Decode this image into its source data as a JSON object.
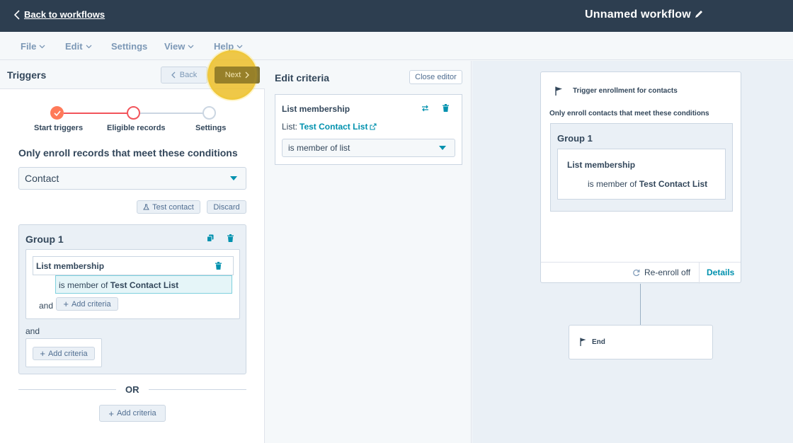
{
  "topbar": {
    "back_label": "Back to workflows",
    "workflow_title": "Unnamed workflow"
  },
  "menu": {
    "file": "File",
    "edit": "Edit",
    "settings": "Settings",
    "view": "View",
    "help": "Help"
  },
  "triggers": {
    "title": "Triggers",
    "back_label": "Back",
    "next_label": "Next",
    "steps": [
      "Start triggers",
      "Eligible records",
      "Settings"
    ],
    "conditions_title": "Only enroll records that meet these conditions",
    "object_select": "Contact",
    "test_contact_label": "Test contact",
    "discard_label": "Discard",
    "group": {
      "title": "Group 1",
      "criteria_title": "List membership",
      "member_prefix": "is member of",
      "list_name": "Test Contact List",
      "and_label": "and",
      "add_criteria_label": "Add criteria"
    },
    "and_label": "and",
    "add_criteria_label": "Add criteria",
    "or_label": "OR",
    "bottom_add_criteria_label": "Add criteria"
  },
  "editor": {
    "title": "Edit criteria",
    "close_label": "Close editor",
    "criteria_title": "List membership",
    "list_prefix": "List:",
    "list_name": "Test Contact List",
    "operator_select": "is member of list"
  },
  "canvas": {
    "trigger_title": "Trigger enrollment for contacts",
    "trigger_sub": "Only enroll contacts that meet these conditions",
    "group_title": "Group 1",
    "criteria_title": "List membership",
    "member_prefix": "is member of",
    "list_name": "Test Contact List",
    "reenroll_label": "Re-enroll off",
    "details_label": "Details",
    "end_label": "End"
  },
  "colors": {
    "topbar": "#2d3e50",
    "accent": "#0091ae",
    "step_active": "#ff7a59",
    "highlight": "#ecbe28"
  }
}
